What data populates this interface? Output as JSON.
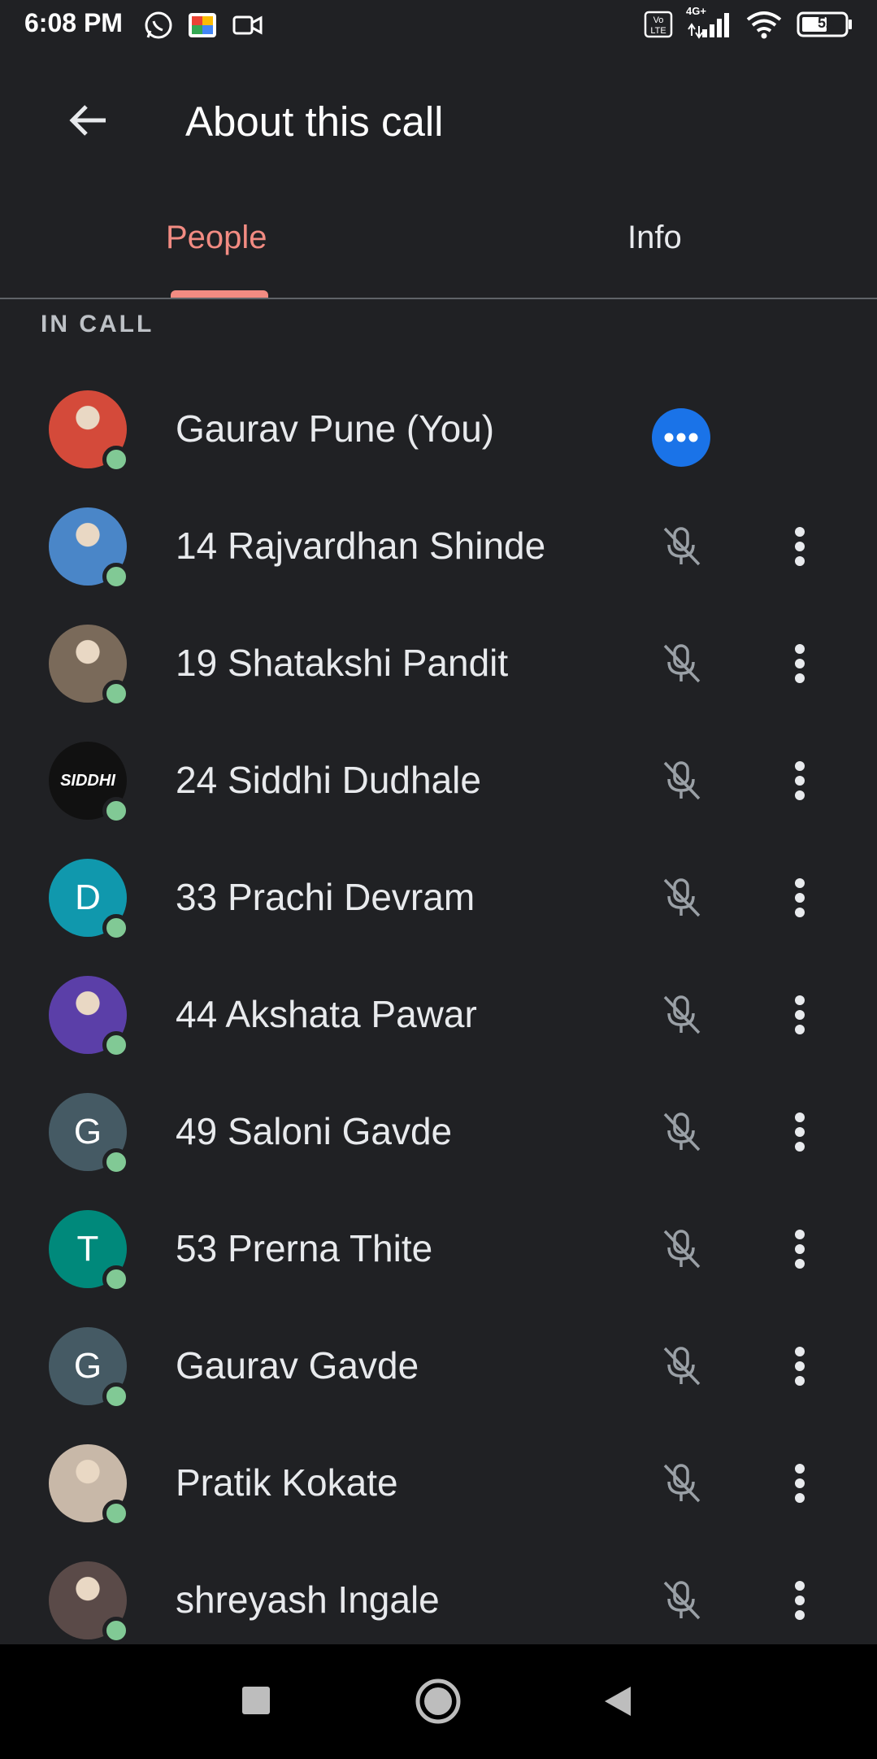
{
  "status_bar": {
    "time": "6:08 PM",
    "icons": [
      "whatsapp-icon",
      "meet-icon",
      "video-icon"
    ],
    "right_icons": [
      "volte-icon",
      "signal-icon",
      "wifi-icon",
      "battery-icon"
    ],
    "network": "4G+",
    "battery": "52"
  },
  "appbar": {
    "title": "About this call"
  },
  "tabs": [
    {
      "label": "People",
      "selected": true
    },
    {
      "label": "Info",
      "selected": false
    }
  ],
  "section_label": "IN CALL",
  "people": [
    {
      "name": "Gaurav Pune (You)",
      "avatar": "photo",
      "color": "#d44a3a",
      "self": true
    },
    {
      "name": "14 Rajvardhan Shinde",
      "avatar": "photo",
      "color": "#4a86c8"
    },
    {
      "name": "19 Shatakshi Pandit",
      "avatar": "photo",
      "color": "#7a6a5a"
    },
    {
      "name": "24 Siddhi Dudhale",
      "avatar": "text-logo",
      "color": "#111111",
      "logo_text": "SIDDHI"
    },
    {
      "name": "33 Prachi Devram",
      "avatar": "letter",
      "letter": "D",
      "color": "#1098ad"
    },
    {
      "name": "44 Akshata Pawar",
      "avatar": "photo",
      "color": "#5b3fa8"
    },
    {
      "name": "49 Saloni Gavde",
      "avatar": "letter",
      "letter": "G",
      "color": "#455a64"
    },
    {
      "name": "53 Prerna Thite",
      "avatar": "letter",
      "letter": "T",
      "color": "#00897b"
    },
    {
      "name": "Gaurav Gavde",
      "avatar": "letter",
      "letter": "G",
      "color": "#455a64"
    },
    {
      "name": "Pratik Kokate",
      "avatar": "photo",
      "color": "#c8b8a8"
    },
    {
      "name": "shreyash Ingale",
      "avatar": "photo",
      "color": "#5a4a48"
    }
  ],
  "colors": {
    "accent": "#f28b82",
    "presence": "#81c995",
    "more_button": "#1a73e8",
    "background": "#202124"
  }
}
